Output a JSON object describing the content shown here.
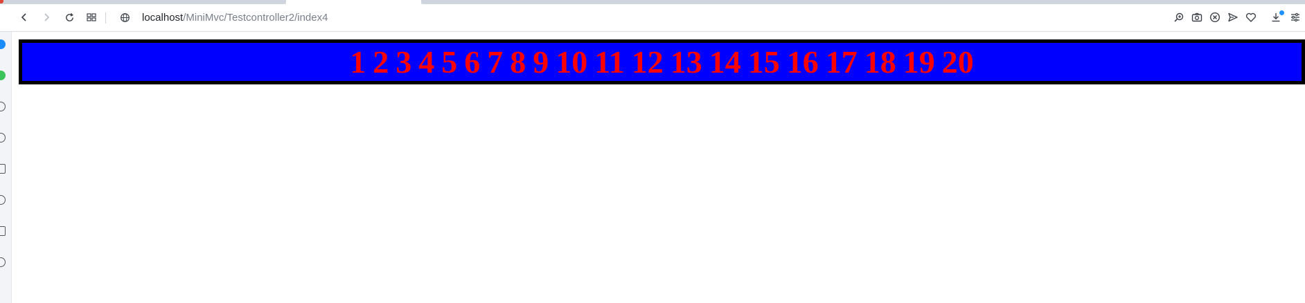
{
  "browser": {
    "url_host": "localhost",
    "url_path": "/MiniMvc/Testcontroller2/index4",
    "toolbar_icons": [
      "back-arrow-icon",
      "forward-arrow-icon",
      "reload-icon",
      "tab-grid-icon",
      "globe-icon"
    ],
    "right_icons": [
      "zoom-icon",
      "camera-icon",
      "block-icon",
      "send-icon",
      "heart-icon",
      "download-icon",
      "settings-sliders-icon"
    ]
  },
  "page": {
    "numbers": [
      "1",
      "2",
      "3",
      "4",
      "5",
      "6",
      "7",
      "8",
      "9",
      "10",
      "11",
      "12",
      "13",
      "14",
      "15",
      "16",
      "17",
      "18",
      "19",
      "20"
    ],
    "box_background": "#0000ff",
    "box_border": "#000000",
    "number_color": "#ff0000"
  }
}
